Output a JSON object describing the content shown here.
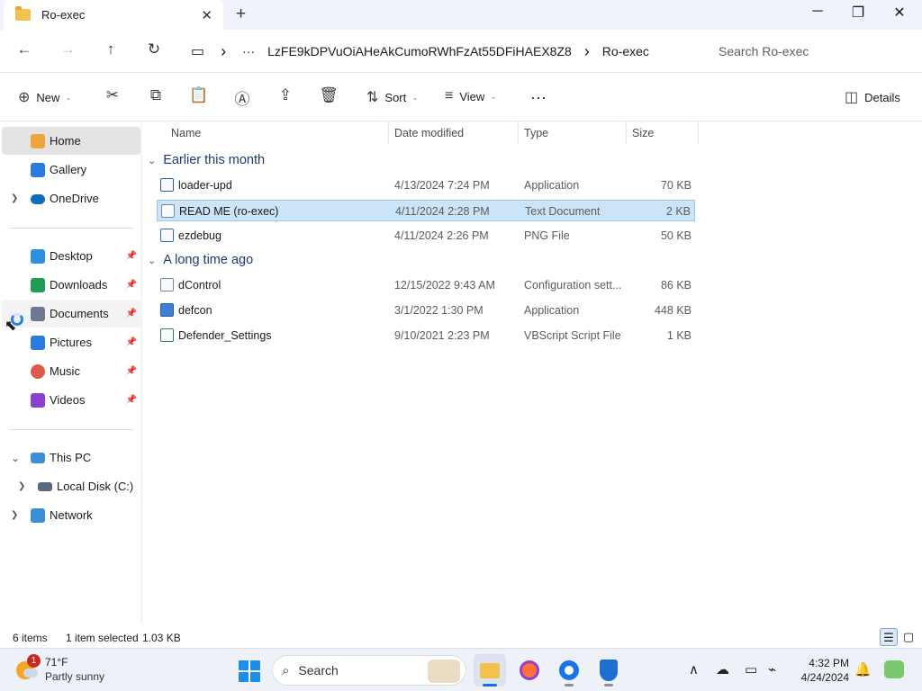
{
  "window": {
    "tab_title": "Ro-exec",
    "tab_close": "✕",
    "new_tab": "+",
    "minimize": "─",
    "maximize": "❐",
    "close": "✕"
  },
  "address": {
    "back": "←",
    "forward": "→",
    "up": "↑",
    "refresh": "↻",
    "computer_icon": "▭",
    "sep": "›",
    "more": "···",
    "crumb_parent": "LzFE9kDPVuOiAHeAkCumoRWhFzAt55DFiHAEX8Z8",
    "crumb_current": "Ro-exec",
    "search_placeholder": "Search Ro-exec"
  },
  "commandbar": {
    "new_label": "New",
    "sort_label": "Sort",
    "view_label": "View",
    "more_label": "···",
    "details_label": "Details"
  },
  "sidebar": {
    "home": "Home",
    "gallery": "Gallery",
    "onedrive": "OneDrive",
    "pinned": [
      {
        "label": "Desktop",
        "icon": "desktop-icon",
        "color": "#2d8fe0"
      },
      {
        "label": "Downloads",
        "icon": "downloads-icon",
        "color": "#1f9d55"
      },
      {
        "label": "Documents",
        "icon": "documents-icon",
        "color": "#6b7a90"
      },
      {
        "label": "Pictures",
        "icon": "pictures-icon",
        "color": "#2a7ae2"
      },
      {
        "label": "Music",
        "icon": "music-icon",
        "color": "#e0584d"
      },
      {
        "label": "Videos",
        "icon": "videos-icon",
        "color": "#8a3fd1"
      }
    ],
    "this_pc": "This PC",
    "local_disk": "Local Disk (C:)",
    "network": "Network"
  },
  "columns": {
    "name": "Name",
    "date": "Date modified",
    "type": "Type",
    "size": "Size"
  },
  "groups": [
    {
      "label": "Earlier this month",
      "files": [
        {
          "name": "loader-upd",
          "date": "4/13/2024 7:24 PM",
          "type": "Application",
          "size": "70 KB",
          "icon": "application-icon",
          "selected": false
        },
        {
          "name": "READ ME (ro-exec)",
          "date": "4/11/2024 2:28 PM",
          "type": "Text Document",
          "size": "2 KB",
          "icon": "text-document-icon",
          "selected": true
        },
        {
          "name": "ezdebug",
          "date": "4/11/2024 2:26 PM",
          "type": "PNG File",
          "size": "50 KB",
          "icon": "png-file-icon",
          "selected": false
        }
      ]
    },
    {
      "label": "A long time ago",
      "files": [
        {
          "name": "dControl",
          "date": "12/15/2022 9:43 AM",
          "type": "Configuration sett...",
          "size": "86 KB",
          "icon": "config-file-icon",
          "selected": false
        },
        {
          "name": "defcon",
          "date": "3/1/2022 1:30 PM",
          "type": "Application",
          "size": "448 KB",
          "icon": "application-icon",
          "selected": false
        },
        {
          "name": "Defender_Settings",
          "date": "9/10/2021 2:23 PM",
          "type": "VBScript Script File",
          "size": "1 KB",
          "icon": "vbscript-file-icon",
          "selected": false
        }
      ]
    }
  ],
  "status": {
    "item_count": "6 items",
    "selection": "1 item selected",
    "selection_size": "1.03 KB"
  },
  "taskbar": {
    "weather_badge": "1",
    "weather_temp": "71°F",
    "weather_cond": "Partly sunny",
    "search_label": "Search",
    "time": "4:32 PM",
    "date": "4/24/2024"
  }
}
